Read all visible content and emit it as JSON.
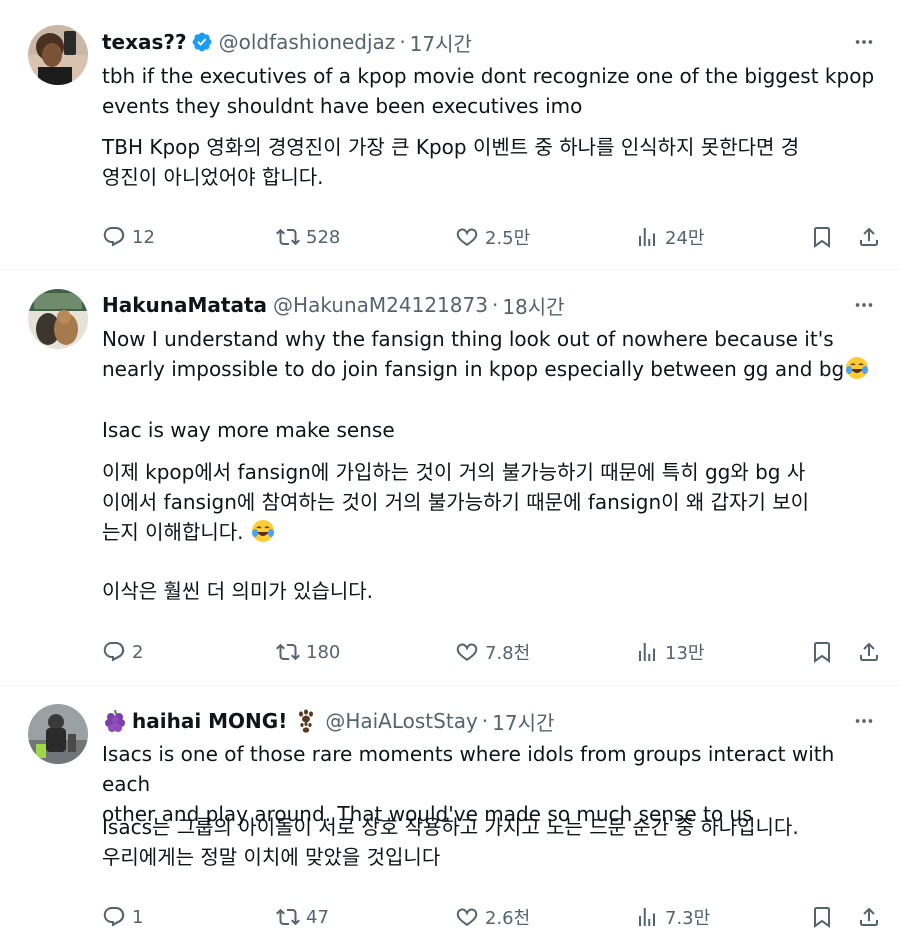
{
  "tweets": [
    {
      "display_name": "texas??",
      "verified": true,
      "handle": "@oldfashionedjaz",
      "separator": "·",
      "time": "17시간",
      "text_original": "tbh if the executives of a kpop movie dont recognize one of the biggest kpop\nevents they shouldnt have been executives imo",
      "text_translated": "TBH Kpop 영화의 경영진이 가장 큰 Kpop 이벤트 중 하나를 인식하지 못한다면 경\n영진이 아니었어야 합니다.",
      "replies": "12",
      "retweets": "528",
      "likes": "2.5만",
      "views": "24만"
    },
    {
      "display_name": "HakunaMatata",
      "verified": false,
      "handle": "@HakunaM24121873",
      "separator": "·",
      "time": "18시간",
      "text_original_1": "Now I understand why the fansign thing look out of nowhere because it's\nnearly impossible to do join fansign in kpop especially between gg and bg",
      "text_original_2": "Isac is way more make sense",
      "text_translated_1": "이제 kpop에서 fansign에 가입하는 것이 거의 불가능하기 때문에 특히 gg와 bg 사\n이에서 fansign에 참여하는 것이 거의 불가능하기 때문에 fansign이 왜 갑자기 보이\n는지 이해합니다. ",
      "text_translated_2": "이삭은 훨씬 더 의미가 있습니다.",
      "replies": "2",
      "retweets": "180",
      "likes": "7.8천",
      "views": "13만"
    },
    {
      "display_name": "haihai MONG!",
      "verified": false,
      "handle": "@HaiALostStay",
      "separator": "·",
      "time": "17시간",
      "text_original": "Isacs is one of those rare moments where idols from groups interact with each\nother and play around. That would've made so much sense to us",
      "text_translated": "Isacs는 그룹의 아이돌이 서로 상호 작용하고 가지고 노는 드문 순간 중 하나입니다.\n우리에게는 정말 이치에 맞았을 것입니다",
      "replies": "1",
      "retweets": "47",
      "likes": "2.6천",
      "views": "7.3만"
    }
  ],
  "icons": {
    "reply": "reply-icon",
    "retweet": "retweet-icon",
    "like": "heart-icon",
    "views": "views-icon",
    "bookmark": "bookmark-icon",
    "share": "share-icon",
    "more": "more-icon",
    "verified": "verified-badge-icon",
    "emoji": "laughing-crying-emoji",
    "name_prefix": "grapes-emoji",
    "name_suffix": "paw-prints-emoji"
  },
  "colors": {
    "text": "#0f1419",
    "secondary": "#536471",
    "verified": "#1d9bf0",
    "divider": "#eff3f4"
  }
}
